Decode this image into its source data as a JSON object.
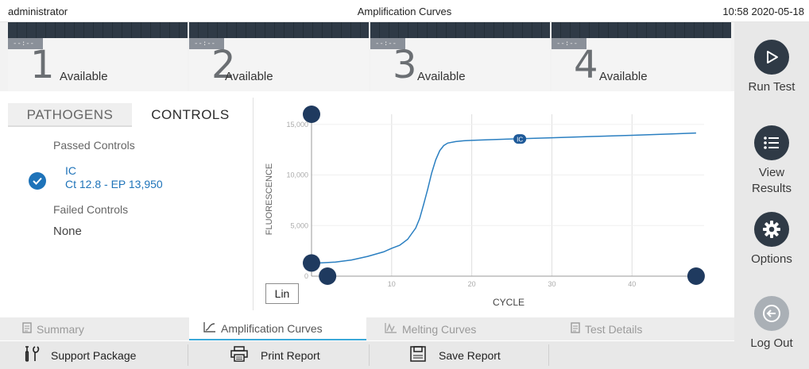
{
  "topbar": {
    "user": "administrator",
    "title": "Amplification Curves",
    "clock": "10:58 2020-05-18"
  },
  "modules": [
    {
      "timer": "--:--",
      "number": "1",
      "status": "Available"
    },
    {
      "timer": "--:--",
      "number": "2",
      "status": "Available"
    },
    {
      "timer": "--:--",
      "number": "3",
      "status": "Available"
    },
    {
      "timer": "--:--",
      "number": "4",
      "status": "Available"
    }
  ],
  "sidebar": {
    "run_test": "Run Test",
    "view_results": "View\nResults",
    "options": "Options",
    "log_out": "Log Out"
  },
  "tabs": {
    "pathogens": "PATHOGENS",
    "controls": "CONTROLS"
  },
  "controls": {
    "passed_heading": "Passed Controls",
    "passed_items": [
      {
        "name": "IC",
        "value": "Ct 12.8  -  EP 13,950"
      }
    ],
    "failed_heading": "Failed Controls",
    "failed_value": "None"
  },
  "scale_button": "Lin",
  "chart_data": {
    "type": "line",
    "xlabel": "CYCLE",
    "ylabel": "FLUORESCENCE",
    "xlim": [
      0,
      49
    ],
    "ylim": [
      0,
      16000
    ],
    "x_ticks": [
      "10",
      "20",
      "30",
      "40"
    ],
    "y_ticks": [
      "0",
      "5,000",
      "10,000",
      "15,000"
    ],
    "series": [
      {
        "name": "IC",
        "x": [
          1,
          3,
          5,
          7,
          9,
          10,
          11,
          12,
          13,
          13.5,
          14,
          14.5,
          15,
          15.5,
          16,
          16.5,
          17,
          18,
          19,
          20,
          22,
          25,
          30,
          35,
          40,
          45,
          48
        ],
        "y": [
          1300,
          1400,
          1600,
          1950,
          2400,
          2750,
          3050,
          3650,
          4750,
          5700,
          7100,
          8600,
          10200,
          11500,
          12400,
          12900,
          13150,
          13300,
          13380,
          13420,
          13480,
          13560,
          13680,
          13800,
          13920,
          14060,
          14150
        ]
      }
    ],
    "series_label": {
      "text": "IC",
      "x": 26,
      "y": 13560
    },
    "handles": [
      {
        "x": 0,
        "y": 16000
      },
      {
        "x": 0,
        "y": 1300
      },
      {
        "x": 2,
        "y": 0
      },
      {
        "x": 48,
        "y": 0
      }
    ],
    "grid": true
  },
  "bottom_tabs": [
    {
      "label": "Summary",
      "icon": "document-icon",
      "active": false
    },
    {
      "label": "Amplification Curves",
      "icon": "curve-icon",
      "active": true
    },
    {
      "label": "Melting Curves",
      "icon": "melt-curve-icon",
      "active": false
    },
    {
      "label": "Test Details",
      "icon": "document-icon",
      "active": false
    }
  ],
  "actions": {
    "support_package": "Support Package",
    "print_report": "Print Report",
    "save_report": "Save Report"
  },
  "colors": {
    "accent": "#1e73b9",
    "dark": "#2f3a46",
    "tab_underline": "#3aa8d8"
  }
}
